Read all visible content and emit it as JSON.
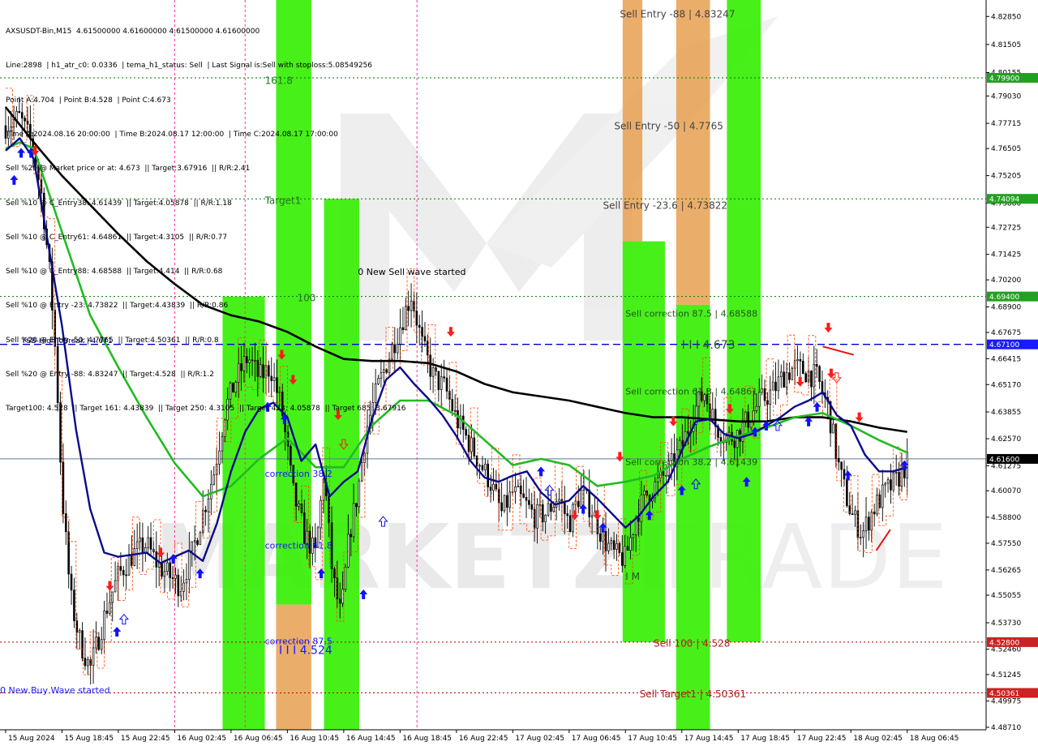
{
  "symbol_header": "AXSUSDT-Bin,M15  4.61500000 4.61600000 4.61500000 4.61600000",
  "info_lines": [
    "Line:2898  | h1_atr_c0: 0.0336  | tema_h1_status: Sell  | Last Signal is:Sell with stoploss:5.08549256",
    "Point A:4.704  | Point B:4.528  | Point C:4.673",
    "Time A:2024.08.16 20:00:00  | Time B:2024.08.17 12:00:00  | Time C:2024.08.17 17:00:00",
    "Sell %20 @ Market price or at: 4.673  || Target:3.67916  || R/R:2.41",
    "Sell %10 @ C_Entry38: 4.61439  || Target:4.05878  || R/R:1.18",
    "Sell %10 @ C_Entry61: 4.64861  || Target:4.3105  || R/R:0.77",
    "Sell %10 @ C_Entry88: 4.68588  || Target:4.414  || R/R:0.68",
    "Sell %10 @ Entry -23: 4.73822  || Target:4.43839  || R/R:0.86",
    "Sell %20 @ Entry -50: 4.7765  || Target:4.50361  || R/R:0.8",
    "Sell %20 @ Entry -88: 4.83247  || Target:4.528  || R/R:1.2",
    "Target100: 4.528  || Target 161: 4.43839  || Target 250: 4.3105  || Target 423: 4.05878  || Target 685: 3.67916"
  ],
  "colors": {
    "background": "#ffffff",
    "bull_candle": "#000000",
    "bear_candle": "#000000",
    "green_zone": "#33ee00",
    "orange_zone": "#e8a050",
    "ma_long": "#000000",
    "ma_mid": "#22bb22",
    "ma_fast": "#0a0a8c",
    "step_line": "#ff4400",
    "buy_arrow": "#1010ff",
    "sell_arrow": "#ff1a1a",
    "level_green": "#006600",
    "level_red": "#b00000",
    "level_blue": "#0000cc"
  },
  "levels": [
    {
      "price": 4.799,
      "color": "#007700",
      "style": "dotted",
      "tag": "4.79900",
      "tag_bg": "#22a022"
    },
    {
      "price": 4.7409,
      "color": "#007700",
      "style": "dotted",
      "tag": "4.74094",
      "tag_bg": "#22a022"
    },
    {
      "price": 4.694,
      "color": "#007700",
      "style": "dotted",
      "tag": "4.69400",
      "tag_bg": "#22a022"
    },
    {
      "price": 4.671,
      "color": "#0000cc",
      "style": "dashed",
      "tag": "4.67100",
      "tag_bg": "#1a1aff"
    },
    {
      "price": 4.616,
      "color": "#5a7a9a",
      "style": "solid",
      "tag": "4.61600",
      "tag_bg": "#000000"
    },
    {
      "price": 4.528,
      "color": "#b00000",
      "style": "dotted",
      "tag": "4.52800",
      "tag_bg": "#cc2222"
    },
    {
      "price": 4.5036,
      "color": "#b00000",
      "style": "dotted",
      "tag": "4.50361",
      "tag_bg": "#cc2222"
    }
  ],
  "labels": [
    {
      "text": "161.8",
      "price": 4.796,
      "time": 9.2,
      "color": "#227722",
      "size": 12
    },
    {
      "text": "Target1",
      "price": 4.7385,
      "time": 9.2,
      "color": "#227722",
      "size": 12
    },
    {
      "text": "100",
      "price": 4.6918,
      "time": 10.35,
      "color": "#227722",
      "size": 12
    },
    {
      "text": "0 New Sell wave started",
      "price": 4.7043,
      "time": 12.5,
      "color": "#000000",
      "size": 11
    },
    {
      "text": "FSB-HighToBreak  |  4.671",
      "price": 4.6716,
      "time": 0.6,
      "color": "#000066",
      "size": 9
    },
    {
      "text": "correction 38.2",
      "price": 4.6075,
      "time": 9.2,
      "color": "#1a1aff",
      "size": 11
    },
    {
      "text": "correction 61.8",
      "price": 4.5729,
      "time": 9.2,
      "color": "#1a1aff",
      "size": 11
    },
    {
      "text": "correction 87.5",
      "price": 4.527,
      "time": 9.2,
      "color": "#1a1aff",
      "size": 11
    },
    {
      "text": "I I I 4.524",
      "price": 4.5223,
      "time": 9.7,
      "color": "#1a1aff",
      "size": 14
    },
    {
      "text": "0 New Buy Wave started",
      "price": 4.5034,
      "time": -0.2,
      "color": "#1a1aff",
      "size": 11
    },
    {
      "text": "Sell Entry -88 | 4.83247",
      "price": 4.828,
      "time": 21.8,
      "color": "#444444",
      "size": 12
    },
    {
      "text": "Sell Entry -50 | 4.7765",
      "price": 4.7743,
      "time": 21.6,
      "color": "#444444",
      "size": 12
    },
    {
      "text": "Sell Entry -23.6 | 4.73822",
      "price": 4.7361,
      "time": 21.2,
      "color": "#444444",
      "size": 12
    },
    {
      "text": "Sell correction 87.5 | 4.68588",
      "price": 4.6843,
      "time": 22.0,
      "color": "#225522",
      "size": 11
    },
    {
      "text": "I I I 4.673",
      "price": 4.669,
      "time": 24.0,
      "color": "#225522",
      "size": 14
    },
    {
      "text": "Sell correction 61.8 | 4.64861",
      "price": 4.647,
      "time": 22.0,
      "color": "#225522",
      "size": 11
    },
    {
      "text": "Sell correction 38.2 | 4.61439",
      "price": 4.613,
      "time": 22.0,
      "color": "#225522",
      "size": 11
    },
    {
      "text": "I M",
      "price": 4.558,
      "time": 22.0,
      "color": "#225522",
      "size": 12
    },
    {
      "text": "Sell 100 | 4.528",
      "price": 4.5259,
      "time": 23.0,
      "color": "#b02020",
      "size": 12
    },
    {
      "text": "Sell Target1 | 4.50361",
      "price": 4.5014,
      "time": 22.5,
      "color": "#b02020",
      "size": 12
    }
  ],
  "time_axis": {
    "labels": [
      "15 Aug 2024",
      "15 Aug 18:45",
      "15 Aug 22:45",
      "16 Aug 02:45",
      "16 Aug 06:45",
      "16 Aug 10:45",
      "16 Aug 14:45",
      "16 Aug 18:45",
      "16 Aug 22:45",
      "17 Aug 02:45",
      "17 Aug 06:45",
      "17 Aug 10:45",
      "17 Aug 14:45",
      "17 Aug 18:45",
      "17 Aug 22:45",
      "18 Aug 02:45",
      "18 Aug 06:45"
    ],
    "label_positions": [
      0,
      2,
      4,
      6,
      8,
      10,
      12,
      14,
      16,
      18,
      20,
      22,
      24,
      26,
      28,
      30,
      32
    ]
  },
  "chart_data": {
    "type": "candlestick",
    "title": "AXSUSDT-Bin,M15",
    "ylim": [
      4.4859,
      4.8364
    ],
    "xlim": [
      -0.2,
      34.8
    ],
    "y_ticks": [
      4.8285,
      4.81505,
      4.80155,
      4.7903,
      4.77715,
      4.76505,
      4.75205,
      4.7388,
      4.72725,
      4.71425,
      4.702,
      4.689,
      4.67675,
      4.66415,
      4.6517,
      4.63855,
      4.6257,
      4.61275,
      4.6007,
      4.588,
      4.5755,
      4.56265,
      4.55055,
      4.5373,
      4.5246,
      4.51245,
      4.49975,
      4.4871
    ],
    "current_price": 4.616,
    "zones": [
      {
        "color": "green",
        "t1": 7.7,
        "t2": 9.2,
        "p1": 4.4859,
        "p2": 4.694
      },
      {
        "color": "green",
        "t1": 9.6,
        "t2": 10.85,
        "p1": 4.546,
        "p2": 4.8364
      },
      {
        "color": "orange",
        "t1": 9.6,
        "t2": 10.85,
        "p1": 4.4859,
        "p2": 4.546
      },
      {
        "color": "green",
        "t1": 11.3,
        "t2": 12.55,
        "p1": 4.4859,
        "p2": 4.7409
      },
      {
        "color": "orange",
        "t1": 21.9,
        "t2": 22.6,
        "p1": 4.7205,
        "p2": 4.8364
      },
      {
        "color": "green",
        "t1": 21.9,
        "t2": 23.4,
        "p1": 4.528,
        "p2": 4.7205
      },
      {
        "color": "orange",
        "t1": 23.8,
        "t2": 25.0,
        "p1": 4.69,
        "p2": 4.8364
      },
      {
        "color": "green",
        "t1": 23.8,
        "t2": 25.0,
        "p1": 4.4859,
        "p2": 4.69
      },
      {
        "color": "green",
        "t1": 25.6,
        "t2": 26.8,
        "p1": 4.528,
        "p2": 4.8364
      }
    ],
    "vlines": [
      {
        "time": 6.0,
        "color": "#ff3399"
      },
      {
        "time": 8.5,
        "color": "#ff3399"
      },
      {
        "time": 14.6,
        "color": "#ff3399"
      }
    ],
    "series": [
      {
        "name": "",
        "kind": "ma",
        "color": "#000000",
        "width": 2.6,
        "t": [
          0,
          1,
          2,
          3,
          4,
          5,
          6,
          7,
          8,
          9,
          10,
          11,
          12,
          13,
          14,
          15,
          16,
          17,
          18,
          19,
          20,
          21,
          22,
          23,
          24,
          25,
          26,
          27,
          28,
          29,
          30,
          31,
          32
        ],
        "p": [
          4.785,
          4.768,
          4.752,
          4.738,
          4.724,
          4.711,
          4.7,
          4.69,
          4.685,
          4.682,
          4.677,
          4.67,
          4.664,
          4.663,
          4.663,
          4.662,
          4.658,
          4.652,
          4.648,
          4.646,
          4.644,
          4.641,
          4.638,
          4.636,
          4.636,
          4.635,
          4.634,
          4.634,
          4.636,
          4.636,
          4.634,
          4.631,
          4.629
        ]
      },
      {
        "name": "",
        "kind": "ma",
        "color": "#22bb22",
        "width": 2.6,
        "t": [
          0,
          0.5,
          1,
          1.5,
          2,
          2.5,
          3,
          4,
          5,
          6,
          7,
          8,
          9,
          10,
          11,
          12,
          13,
          14,
          15,
          16,
          17,
          18,
          19,
          20,
          21,
          22,
          23,
          24,
          25,
          26,
          27,
          28,
          29,
          30,
          31,
          32
        ],
        "p": [
          4.765,
          4.768,
          4.765,
          4.745,
          4.725,
          4.705,
          4.685,
          4.66,
          4.636,
          4.614,
          4.598,
          4.603,
          4.616,
          4.626,
          4.612,
          4.612,
          4.632,
          4.644,
          4.644,
          4.637,
          4.625,
          4.613,
          4.616,
          4.613,
          4.603,
          4.605,
          4.608,
          4.616,
          4.622,
          4.627,
          4.631,
          4.636,
          4.638,
          4.632,
          4.625,
          4.619
        ]
      },
      {
        "name": "",
        "kind": "ma",
        "color": "#0a0a8c",
        "width": 2.4,
        "t": [
          0,
          0.5,
          1,
          1.5,
          2,
          2.5,
          3,
          3.5,
          4,
          4.5,
          5,
          5.5,
          6,
          6.5,
          7,
          7.5,
          8,
          8.5,
          9,
          9.5,
          10,
          10.5,
          11,
          11.5,
          12,
          12.5,
          13,
          13.5,
          14,
          14.5,
          15,
          15.5,
          16,
          16.5,
          17,
          17.5,
          18,
          18.5,
          19,
          19.5,
          20,
          20.5,
          21,
          21.5,
          22,
          22.5,
          23,
          23.5,
          24,
          24.5,
          25,
          25.5,
          26,
          26.5,
          27,
          27.5,
          28,
          28.5,
          29,
          29.5,
          30,
          30.5,
          31,
          31.5,
          32
        ],
        "p": [
          4.764,
          4.77,
          4.76,
          4.72,
          4.68,
          4.63,
          4.592,
          4.571,
          4.569,
          4.57,
          4.571,
          4.566,
          4.569,
          4.572,
          4.567,
          4.585,
          4.61,
          4.629,
          4.64,
          4.643,
          4.636,
          4.615,
          4.623,
          4.598,
          4.605,
          4.61,
          4.635,
          4.654,
          4.66,
          4.652,
          4.645,
          4.637,
          4.627,
          4.615,
          4.607,
          4.605,
          4.608,
          4.61,
          4.6,
          4.594,
          4.596,
          4.603,
          4.597,
          4.59,
          4.583,
          4.589,
          4.598,
          4.605,
          4.62,
          4.634,
          4.635,
          4.628,
          4.626,
          4.628,
          4.632,
          4.636,
          4.641,
          4.644,
          4.648,
          4.637,
          4.632,
          4.618,
          4.61,
          4.61,
          4.612
        ]
      }
    ],
    "candle_generator": {
      "count": 330,
      "t_start": 0.0,
      "t_end": 32.0,
      "anchors_t": [
        0,
        0.5,
        1,
        1.3,
        1.6,
        1.8,
        2.0,
        2.3,
        2.6,
        3.0,
        3.3,
        3.6,
        4.0,
        4.5,
        5.0,
        5.4,
        5.8,
        6.2,
        6.6,
        7.0,
        7.4,
        7.8,
        8.2,
        8.6,
        9.0,
        9.4,
        9.8,
        10.2,
        10.6,
        11.0,
        11.3,
        11.6,
        11.9,
        12.2,
        12.5,
        12.8,
        13.2,
        13.6,
        14.0,
        14.4,
        14.8,
        15.2,
        15.6,
        16.0,
        16.4,
        16.8,
        17.2,
        17.6,
        18.0,
        18.4,
        18.8,
        19.2,
        19.6,
        20.0,
        20.4,
        20.8,
        21.2,
        21.6,
        22.0,
        22.4,
        22.8,
        23.2,
        23.6,
        24.0,
        24.4,
        24.8,
        25.2,
        25.6,
        26.0,
        26.4,
        26.8,
        27.2,
        27.6,
        28.0,
        28.4,
        28.8,
        29.2,
        29.6,
        30.0,
        30.4,
        30.8,
        31.2,
        31.6,
        32.0
      ],
      "anchors_p": [
        4.776,
        4.78,
        4.765,
        4.74,
        4.7,
        4.66,
        4.6,
        4.55,
        4.53,
        4.515,
        4.53,
        4.545,
        4.56,
        4.57,
        4.575,
        4.565,
        4.56,
        4.555,
        4.57,
        4.59,
        4.61,
        4.64,
        4.655,
        4.665,
        4.655,
        4.66,
        4.64,
        4.6,
        4.58,
        4.57,
        4.61,
        4.56,
        4.54,
        4.58,
        4.6,
        4.63,
        4.65,
        4.665,
        4.68,
        4.695,
        4.67,
        4.655,
        4.65,
        4.635,
        4.625,
        4.615,
        4.605,
        4.59,
        4.6,
        4.595,
        4.588,
        4.59,
        4.598,
        4.585,
        4.6,
        4.592,
        4.578,
        4.57,
        4.568,
        4.59,
        4.6,
        4.605,
        4.612,
        4.622,
        4.638,
        4.648,
        4.632,
        4.626,
        4.628,
        4.636,
        4.644,
        4.648,
        4.656,
        4.66,
        4.658,
        4.655,
        4.64,
        4.61,
        4.59,
        4.58,
        4.592,
        4.6,
        4.605,
        4.614
      ],
      "wick": 0.01
    },
    "buy_arrows": [
      {
        "t": 0.3,
        "p": 4.75
      },
      {
        "t": 0.55,
        "p": 4.763
      },
      {
        "t": 0.9,
        "p": 4.763
      },
      {
        "t": 3.95,
        "p": 4.533
      },
      {
        "t": 5.95,
        "p": 4.568
      },
      {
        "t": 6.9,
        "p": 4.561
      },
      {
        "t": 9.3,
        "p": 4.641
      },
      {
        "t": 9.9,
        "p": 4.635
      },
      {
        "t": 11.2,
        "p": 4.561
      },
      {
        "t": 12.7,
        "p": 4.551
      },
      {
        "t": 19.0,
        "p": 4.61
      },
      {
        "t": 20.5,
        "p": 4.592
      },
      {
        "t": 21.2,
        "p": 4.583
      },
      {
        "t": 22.85,
        "p": 4.589
      },
      {
        "t": 24.0,
        "p": 4.601
      },
      {
        "t": 26.3,
        "p": 4.605
      },
      {
        "t": 26.6,
        "p": 4.629
      },
      {
        "t": 27.0,
        "p": 4.632
      },
      {
        "t": 28.5,
        "p": 4.634
      },
      {
        "t": 28.8,
        "p": 4.641
      },
      {
        "t": 29.9,
        "p": 4.608
      },
      {
        "t": 31.9,
        "p": 4.613
      }
    ],
    "sell_arrows": [
      {
        "t": 1.05,
        "p": 4.764
      },
      {
        "t": 3.7,
        "p": 4.555
      },
      {
        "t": 5.5,
        "p": 4.571
      },
      {
        "t": 9.8,
        "p": 4.666
      },
      {
        "t": 10.2,
        "p": 4.654
      },
      {
        "t": 11.8,
        "p": 4.637
      },
      {
        "t": 15.8,
        "p": 4.677
      },
      {
        "t": 20.2,
        "p": 4.589
      },
      {
        "t": 21.0,
        "p": 4.589
      },
      {
        "t": 21.8,
        "p": 4.617
      },
      {
        "t": 23.7,
        "p": 4.634
      },
      {
        "t": 25.7,
        "p": 4.64
      },
      {
        "t": 28.2,
        "p": 4.653
      },
      {
        "t": 29.3,
        "p": 4.657
      },
      {
        "t": 29.2,
        "p": 4.679
      },
      {
        "t": 30.3,
        "p": 4.636
      }
    ],
    "hollow_buy_arrows": [
      {
        "t": 4.2,
        "p": 4.539
      },
      {
        "t": 13.4,
        "p": 4.586
      },
      {
        "t": 19.3,
        "p": 4.601
      },
      {
        "t": 24.5,
        "p": 4.604
      },
      {
        "t": 27.4,
        "p": 4.632
      }
    ],
    "hollow_sell_arrows": [
      {
        "t": 12.0,
        "p": 4.623
      },
      {
        "t": 29.5,
        "p": 4.655
      }
    ],
    "red_segments": [
      {
        "t1": 29.0,
        "p1": 4.67,
        "t2": 30.1,
        "p2": 4.666
      },
      {
        "t1": 30.9,
        "p1": 4.572,
        "t2": 31.4,
        "p2": 4.582
      }
    ]
  }
}
